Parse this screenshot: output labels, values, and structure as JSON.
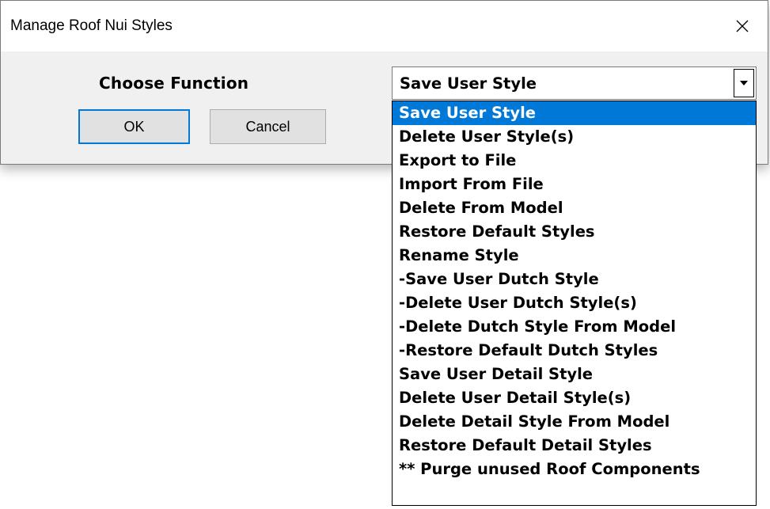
{
  "window": {
    "title": "Manage Roof Nui Styles",
    "close_icon": "close-icon"
  },
  "form": {
    "label": "Choose Function",
    "ok_label": "OK",
    "cancel_label": "Cancel"
  },
  "combo": {
    "selected": "Save User Style",
    "arrow_icon": "chevron-down-icon"
  },
  "dropdown": {
    "highlight_color": "#0078d7",
    "selected_index": 0,
    "items": [
      "Save User Style",
      "Delete User Style(s)",
      "Export to File",
      "Import From File",
      "Delete From Model",
      "Restore Default Styles",
      "Rename Style",
      "-Save User Dutch Style",
      "-Delete User Dutch Style(s)",
      "-Delete Dutch Style From Model",
      "-Restore Default Dutch Styles",
      "Save User Detail Style",
      "Delete User Detail Style(s)",
      "Delete Detail Style From Model",
      "Restore Default Detail Styles",
      "** Purge unused Roof Components"
    ]
  }
}
